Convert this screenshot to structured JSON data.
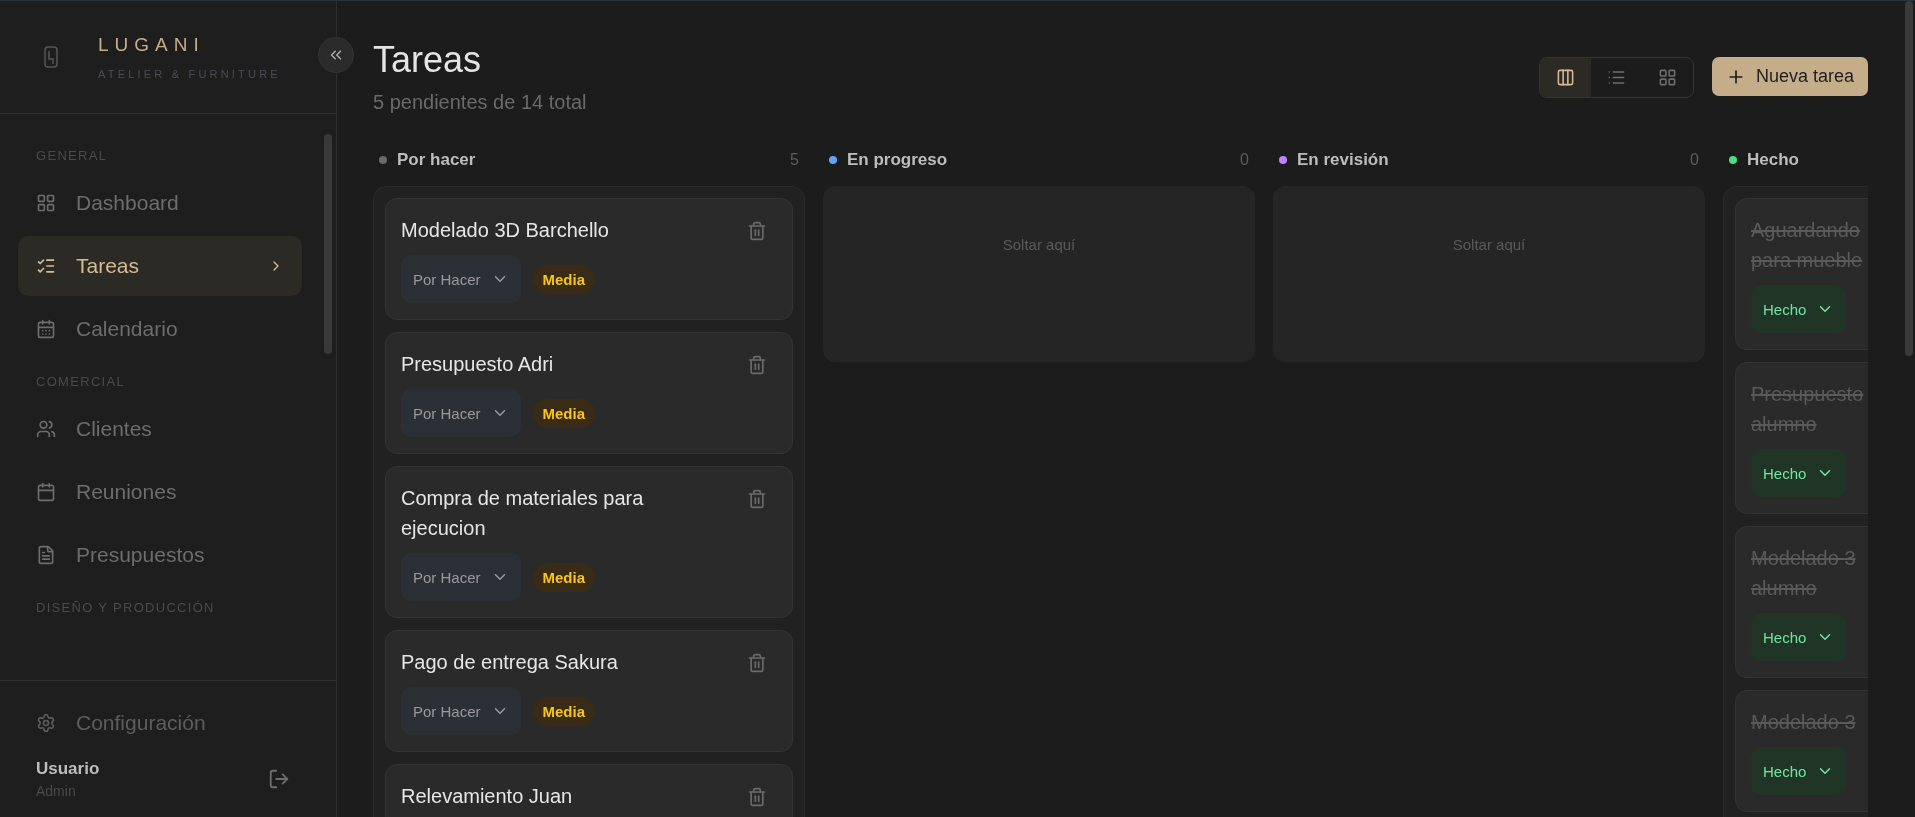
{
  "sidebar": {
    "brand": {
      "name": "LUGANI",
      "tagline": "ATELIER & FURNITURE"
    },
    "sections": [
      {
        "title": "GENERAL",
        "items": [
          {
            "label": "Dashboard",
            "selected": false
          },
          {
            "label": "Tareas",
            "selected": true
          },
          {
            "label": "Calendario",
            "selected": false
          }
        ]
      },
      {
        "title": "COMERCIAL",
        "items": [
          {
            "label": "Clientes",
            "selected": false
          },
          {
            "label": "Reuniones",
            "selected": false
          },
          {
            "label": "Presupuestos",
            "selected": false
          }
        ]
      },
      {
        "title": "DISEÑO Y PRODUCCIÓN"
      }
    ],
    "settings": {
      "label": "Configuración"
    },
    "user": {
      "name": "Usuario",
      "role": "Admin"
    }
  },
  "header": {
    "title": "Tareas",
    "subtitle": "5 pendientes de 14 total",
    "views": [
      {
        "selected": true
      },
      {
        "selected": false
      },
      {
        "selected": false
      }
    ],
    "new_button": "Nueva tarea"
  },
  "columns": [
    {
      "title": "Por hacer",
      "count": "5",
      "color": "#6b6b6b",
      "cards": [
        {
          "title": "Modelado 3D Barchello",
          "status": "Por Hacer",
          "kind": "todo",
          "priority": "Media",
          "done": false
        },
        {
          "title": "Presupuesto Adri",
          "status": "Por Hacer",
          "kind": "todo",
          "priority": "Media",
          "done": false
        },
        {
          "title": "Compra de materiales para ejecucion",
          "status": "Por Hacer",
          "kind": "todo",
          "priority": "Media",
          "done": false
        },
        {
          "title": "Pago de entrega Sakura",
          "status": "Por Hacer",
          "kind": "todo",
          "priority": "Media",
          "done": false
        },
        {
          "title": "Relevamiento Juan",
          "done": false
        }
      ]
    },
    {
      "title": "En progreso",
      "count": "0",
      "color": "#60a5fa",
      "empty_text": "Soltar aquí"
    },
    {
      "title": "En revisión",
      "count": "0",
      "color": "#c084fc",
      "empty_text": "Soltar aquí"
    },
    {
      "title": "Hecho",
      "color": "#4ade80",
      "cards": [
        {
          "title": "Aguardando para mueble",
          "status": "Hecho",
          "kind": "done",
          "done": true
        },
        {
          "title": "Presupuesto alumno",
          "status": "Hecho",
          "kind": "done",
          "done": true
        },
        {
          "title": "Modelado 3 alumno",
          "status": "Hecho",
          "kind": "done",
          "done": true
        },
        {
          "title": "Modelado 3",
          "status": "Hecho",
          "kind": "done",
          "done": true
        }
      ]
    }
  ]
}
